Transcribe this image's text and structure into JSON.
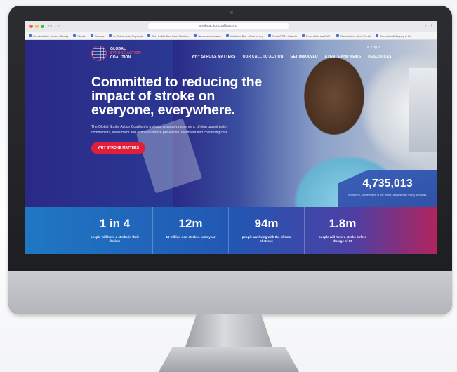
{
  "browser": {
    "url": "strokeactioncoalition.org",
    "bookmarks": [
      "Feedback for Johann Sturdy",
      "Stroke",
      "Canvas",
      "ic.Welcome to Sc.portal",
      "Ski Health Blue Care Platform",
      "Nurse store brand",
      "Medicine Bay - Courier.org",
      "SmartPCT - Search",
      "Power Microsoft WH",
      "Summarize - Live Portal",
      "Greenline & Jaquiry & Gr"
    ]
  },
  "site": {
    "logo": {
      "line1": "GLOBAL",
      "line2": "STROKE ACTION",
      "line3": "COALITION"
    },
    "login": "Log in",
    "nav": [
      "WHY STROKE MATTERS",
      "OUR CALL TO ACTION",
      "GET INVOLVED",
      "EVENTS AND NEWS",
      "RESOURCES"
    ],
    "hero": {
      "title": "Committed to reducing the impact of stroke on everyone, everywhere.",
      "body": "The Global Stroke Action Coalition is a global advocacy movement, driving urgent policy commitment, investment and action on stroke prevention, treatment and continuing care.",
      "cta": "WHY STROKE MATTERS"
    },
    "counter": {
      "value": "4,735,013",
      "caption": "Someone, somewhere in the world has a stroke every seconds."
    },
    "stats": [
      {
        "value": "1 in 4",
        "label": "people will have a stroke in their lifetime"
      },
      {
        "value": "12m",
        "label": "12 million new strokes each year"
      },
      {
        "value": "94m",
        "label": "people are living with the effects of stroke"
      },
      {
        "value": "1.8m",
        "label": "people will have a stroke before the age of 50"
      }
    ]
  },
  "colors": {
    "brand_navy": "#25237e",
    "accent_red": "#e11f3a",
    "logo_pink": "#e34b6a"
  }
}
